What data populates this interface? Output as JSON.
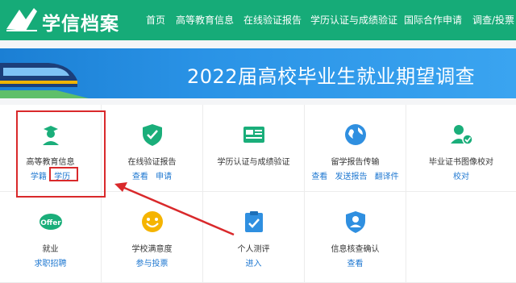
{
  "brand": {
    "name": "学信档案"
  },
  "nav": [
    "首页",
    "高等教育信息",
    "在线验证报告",
    "学历认证与成绩验证",
    "国际合作申请",
    "调查/投票"
  ],
  "banner": {
    "title": "2022届高校毕业生就业期望调查"
  },
  "services": [
    {
      "name": "高等教育信息",
      "icon": "graduate-icon",
      "links": [
        "学籍",
        "学历"
      ]
    },
    {
      "name": "在线验证报告",
      "icon": "shield-check-icon",
      "links": [
        "查看",
        "申请"
      ]
    },
    {
      "name": "学历认证与成绩验证",
      "icon": "id-card-icon",
      "links": []
    },
    {
      "name": "留学报告传输",
      "icon": "globe-icon",
      "links": [
        "查看",
        "发送报告",
        "翻译件"
      ]
    },
    {
      "name": "毕业证书图像校对",
      "icon": "user-check-icon",
      "links": [
        "校对"
      ]
    },
    {
      "name": "就业",
      "icon": "offer-icon",
      "icon_text": "Offer",
      "links": [
        "求职招聘"
      ]
    },
    {
      "name": "学校满意度",
      "icon": "smiley-icon",
      "links": [
        "参与投票"
      ]
    },
    {
      "name": "个人测评",
      "icon": "clipboard-check-icon",
      "links": [
        "进入"
      ]
    },
    {
      "name": "信息核查确认",
      "icon": "person-shield-icon",
      "links": [
        "查看"
      ]
    }
  ],
  "colors": {
    "header": "#16ab78",
    "accent_green": "#1aae7a",
    "link": "#1f78d1",
    "highlight": "#d9292b",
    "banner": "#2a93e6"
  }
}
